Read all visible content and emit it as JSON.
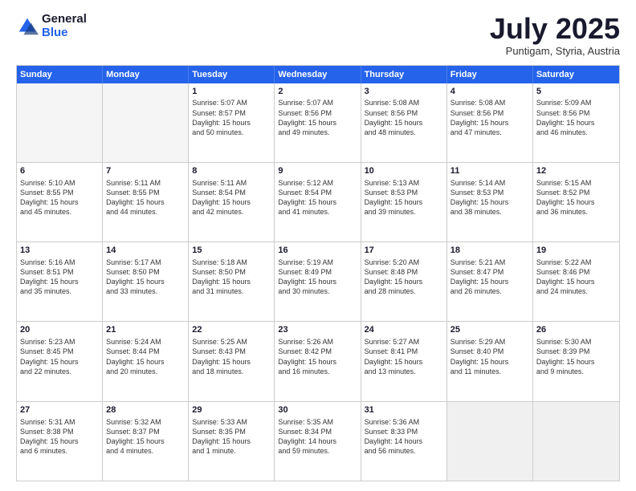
{
  "logo": {
    "general": "General",
    "blue": "Blue"
  },
  "title": "July 2025",
  "subtitle": "Puntigam, Styria, Austria",
  "header_days": [
    "Sunday",
    "Monday",
    "Tuesday",
    "Wednesday",
    "Thursday",
    "Friday",
    "Saturday"
  ],
  "rows": [
    [
      {
        "day": "",
        "text": "",
        "empty": true
      },
      {
        "day": "",
        "text": "",
        "empty": true
      },
      {
        "day": "1",
        "text": "Sunrise: 5:07 AM\nSunset: 8:57 PM\nDaylight: 15 hours\nand 50 minutes."
      },
      {
        "day": "2",
        "text": "Sunrise: 5:07 AM\nSunset: 8:56 PM\nDaylight: 15 hours\nand 49 minutes."
      },
      {
        "day": "3",
        "text": "Sunrise: 5:08 AM\nSunset: 8:56 PM\nDaylight: 15 hours\nand 48 minutes."
      },
      {
        "day": "4",
        "text": "Sunrise: 5:08 AM\nSunset: 8:56 PM\nDaylight: 15 hours\nand 47 minutes."
      },
      {
        "day": "5",
        "text": "Sunrise: 5:09 AM\nSunset: 8:56 PM\nDaylight: 15 hours\nand 46 minutes."
      }
    ],
    [
      {
        "day": "6",
        "text": "Sunrise: 5:10 AM\nSunset: 8:55 PM\nDaylight: 15 hours\nand 45 minutes."
      },
      {
        "day": "7",
        "text": "Sunrise: 5:11 AM\nSunset: 8:55 PM\nDaylight: 15 hours\nand 44 minutes."
      },
      {
        "day": "8",
        "text": "Sunrise: 5:11 AM\nSunset: 8:54 PM\nDaylight: 15 hours\nand 42 minutes."
      },
      {
        "day": "9",
        "text": "Sunrise: 5:12 AM\nSunset: 8:54 PM\nDaylight: 15 hours\nand 41 minutes."
      },
      {
        "day": "10",
        "text": "Sunrise: 5:13 AM\nSunset: 8:53 PM\nDaylight: 15 hours\nand 39 minutes."
      },
      {
        "day": "11",
        "text": "Sunrise: 5:14 AM\nSunset: 8:53 PM\nDaylight: 15 hours\nand 38 minutes."
      },
      {
        "day": "12",
        "text": "Sunrise: 5:15 AM\nSunset: 8:52 PM\nDaylight: 15 hours\nand 36 minutes."
      }
    ],
    [
      {
        "day": "13",
        "text": "Sunrise: 5:16 AM\nSunset: 8:51 PM\nDaylight: 15 hours\nand 35 minutes."
      },
      {
        "day": "14",
        "text": "Sunrise: 5:17 AM\nSunset: 8:50 PM\nDaylight: 15 hours\nand 33 minutes."
      },
      {
        "day": "15",
        "text": "Sunrise: 5:18 AM\nSunset: 8:50 PM\nDaylight: 15 hours\nand 31 minutes."
      },
      {
        "day": "16",
        "text": "Sunrise: 5:19 AM\nSunset: 8:49 PM\nDaylight: 15 hours\nand 30 minutes."
      },
      {
        "day": "17",
        "text": "Sunrise: 5:20 AM\nSunset: 8:48 PM\nDaylight: 15 hours\nand 28 minutes."
      },
      {
        "day": "18",
        "text": "Sunrise: 5:21 AM\nSunset: 8:47 PM\nDaylight: 15 hours\nand 26 minutes."
      },
      {
        "day": "19",
        "text": "Sunrise: 5:22 AM\nSunset: 8:46 PM\nDaylight: 15 hours\nand 24 minutes."
      }
    ],
    [
      {
        "day": "20",
        "text": "Sunrise: 5:23 AM\nSunset: 8:45 PM\nDaylight: 15 hours\nand 22 minutes."
      },
      {
        "day": "21",
        "text": "Sunrise: 5:24 AM\nSunset: 8:44 PM\nDaylight: 15 hours\nand 20 minutes."
      },
      {
        "day": "22",
        "text": "Sunrise: 5:25 AM\nSunset: 8:43 PM\nDaylight: 15 hours\nand 18 minutes."
      },
      {
        "day": "23",
        "text": "Sunrise: 5:26 AM\nSunset: 8:42 PM\nDaylight: 15 hours\nand 16 minutes."
      },
      {
        "day": "24",
        "text": "Sunrise: 5:27 AM\nSunset: 8:41 PM\nDaylight: 15 hours\nand 13 minutes."
      },
      {
        "day": "25",
        "text": "Sunrise: 5:29 AM\nSunset: 8:40 PM\nDaylight: 15 hours\nand 11 minutes."
      },
      {
        "day": "26",
        "text": "Sunrise: 5:30 AM\nSunset: 8:39 PM\nDaylight: 15 hours\nand 9 minutes."
      }
    ],
    [
      {
        "day": "27",
        "text": "Sunrise: 5:31 AM\nSunset: 8:38 PM\nDaylight: 15 hours\nand 6 minutes."
      },
      {
        "day": "28",
        "text": "Sunrise: 5:32 AM\nSunset: 8:37 PM\nDaylight: 15 hours\nand 4 minutes."
      },
      {
        "day": "29",
        "text": "Sunrise: 5:33 AM\nSunset: 8:35 PM\nDaylight: 15 hours\nand 1 minute."
      },
      {
        "day": "30",
        "text": "Sunrise: 5:35 AM\nSunset: 8:34 PM\nDaylight: 14 hours\nand 59 minutes."
      },
      {
        "day": "31",
        "text": "Sunrise: 5:36 AM\nSunset: 8:33 PM\nDaylight: 14 hours\nand 56 minutes."
      },
      {
        "day": "",
        "text": "",
        "empty": true,
        "shaded": true
      },
      {
        "day": "",
        "text": "",
        "empty": true,
        "shaded": true
      }
    ]
  ]
}
